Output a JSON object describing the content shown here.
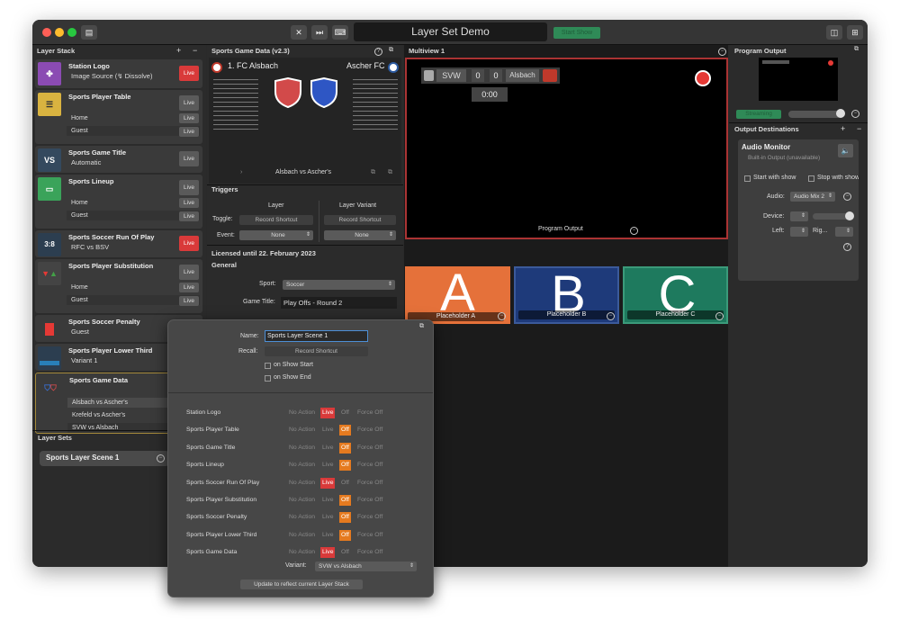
{
  "window": {
    "title": "Layer Set Demo",
    "start_show": "Start Show"
  },
  "layer_stack": {
    "header": "Layer Stack",
    "items": [
      {
        "title": "Station Logo",
        "sub": "Image Source (↯ Dissolve)",
        "icon": "⚙"
      },
      {
        "title": "Sports Player Table",
        "variants": [
          "Home",
          "Guest"
        ]
      },
      {
        "title": "Sports Game Title",
        "sub": "Automatic",
        "icon": "VS"
      },
      {
        "title": "Sports Lineup",
        "variants": [
          "Home",
          "Guest"
        ]
      },
      {
        "title": "Sports Soccer Run Of Play",
        "sub": "RFC vs BSV",
        "icon": "3:8"
      },
      {
        "title": "Sports Player Substitution",
        "variants": [
          "Home",
          "Guest"
        ]
      },
      {
        "title": "Sports Soccer Penalty",
        "sub": "Guest"
      },
      {
        "title": "Sports Player Lower Third",
        "sub": "Variant 1"
      },
      {
        "title": "Sports Game Data",
        "variants": [
          "Alsbach vs Ascher's",
          "Krefeld vs Ascher's",
          "SVW vs Alsbach"
        ]
      }
    ],
    "live": "Live"
  },
  "layer_sets": {
    "header": "Layer Sets",
    "selected": "Sports Layer Scene 1"
  },
  "game_data": {
    "header": "Sports Game Data (v2.3)",
    "home": "1. FC Alsbach",
    "away": "Ascher FC",
    "footer": "Alsbach vs Ascher's",
    "triggers": "Triggers",
    "layer": "Layer",
    "layer_variant": "Layer Variant",
    "toggle": "Toggle:",
    "record_shortcut": "Record Shortcut",
    "event": "Event:",
    "none": "None",
    "licensed": "Licensed until 22. February 2023",
    "general": "General",
    "sport_label": "Sport:",
    "sport": "Soccer",
    "game_title_label": "Game Title:",
    "game_title": "Play Offs - Round 2"
  },
  "popover": {
    "name_label": "Name:",
    "name": "Sports Layer Scene 1",
    "recall_label": "Recall:",
    "recall": "Record Shortcut",
    "on_start": "on Show Start",
    "on_end": "on Show End",
    "opts": [
      "No Action",
      "Live",
      "Off",
      "Force Off"
    ],
    "rows": [
      {
        "name": "Station Logo",
        "state": "Live"
      },
      {
        "name": "Sports Player Table",
        "state": "Off"
      },
      {
        "name": "Sports Game Title",
        "state": "Off"
      },
      {
        "name": "Sports Lineup",
        "state": "Off"
      },
      {
        "name": "Sports Soccer Run Of Play",
        "state": "Live"
      },
      {
        "name": "Sports Player Substitution",
        "state": "Off"
      },
      {
        "name": "Sports Soccer Penalty",
        "state": "Off"
      },
      {
        "name": "Sports Player Lower Third",
        "state": "Off"
      },
      {
        "name": "Sports Game Data",
        "state": "Live"
      }
    ],
    "variant_label": "Variant:",
    "variant": "SVW vs Alsbach",
    "update": "Update to reflect current Layer Stack"
  },
  "multiview": {
    "header": "Multiview 1",
    "score": {
      "team1": "SVW",
      "s1": "0",
      "s2": "0",
      "team2": "Alsbach",
      "time": "0:00"
    },
    "program_output": "Program Output",
    "placeholders": [
      {
        "letter": "A",
        "label": "Placeholder A",
        "color": "#e5713a"
      },
      {
        "letter": "B",
        "label": "Placeholder B",
        "color": "#1e3a7a"
      },
      {
        "letter": "C",
        "label": "Placeholder C",
        "color": "#1e7a5e"
      }
    ]
  },
  "program_output": {
    "header": "Program Output",
    "stream": "Streaming"
  },
  "output_destinations": {
    "header": "Output Destinations",
    "audio_monitor": "Audio Monitor",
    "builtin": "Built-in Output (unavailable)",
    "start_with_show": "Start with show",
    "stop_with_show": "Stop with show",
    "audio_label": "Audio:",
    "audio": "Audio Mix 2",
    "device_label": "Device:",
    "left_label": "Left:",
    "right_label": "Rig..."
  }
}
